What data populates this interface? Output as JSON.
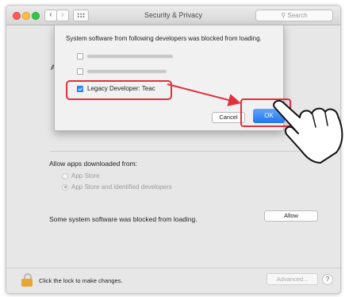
{
  "window": {
    "title": "Security & Privacy"
  },
  "search": {
    "placeholder": "Search"
  },
  "background": {
    "partial_letter": "A",
    "allow_heading": "Allow apps downloaded from:",
    "radio_options": [
      {
        "label": "App Store",
        "selected": false
      },
      {
        "label": "App Store and identified developers",
        "selected": true
      }
    ],
    "blocked_message": "Some system software was blocked from loading.",
    "allow_button": "Allow"
  },
  "sheet": {
    "message": "System software from following developers was blocked from loading.",
    "developers": [
      {
        "label": "",
        "blurred": true,
        "checked": false
      },
      {
        "label": "",
        "blurred": true,
        "checked": false
      },
      {
        "label": "Legacy Developer: Teac",
        "blurred": false,
        "checked": true
      }
    ],
    "cancel_button": "Cancel",
    "ok_button": "OK"
  },
  "footer": {
    "lock_text": "Click the lock to make changes.",
    "advanced_button": "Advanced...",
    "help_glyph": "?"
  },
  "icons": [
    "lock-icon",
    "hand-pointer-icon",
    "arrow-icon",
    "back-chevron-icon",
    "forward-chevron-icon",
    "grid-icon",
    "search-icon"
  ],
  "colors": {
    "highlight": "#e0303a",
    "accent": "#2e88f2",
    "lock": "#e6a534"
  }
}
